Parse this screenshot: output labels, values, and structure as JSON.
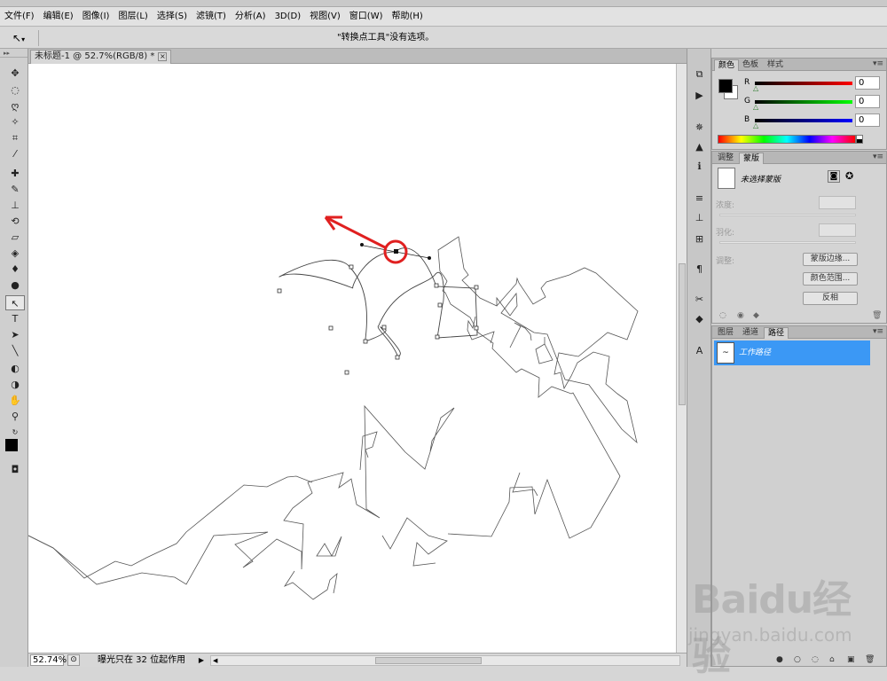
{
  "menu": [
    "文件(F)",
    "编辑(E)",
    "图像(I)",
    "图层(L)",
    "选择(S)",
    "滤镜(T)",
    "分析(A)",
    "3D(D)",
    "视图(V)",
    "窗口(W)",
    "帮助(H)"
  ],
  "options_bar": {
    "tool_icon": "convert-point-icon",
    "message": "\"转换点工具\"没有选项。"
  },
  "document": {
    "tab_title": "未标题-1 @ 52.7%(RGB/8) *",
    "close_glyph": "×"
  },
  "status": {
    "zoom": "52.74%",
    "text": "曝光只在 32 位起作用",
    "arrow": "▶",
    "left_arrow": "◀"
  },
  "color_panel": {
    "tabs": [
      "颜色",
      "色板",
      "样式"
    ],
    "active_tab": "颜色",
    "channels": [
      {
        "label": "R",
        "value": "0",
        "gradient": "red"
      },
      {
        "label": "G",
        "value": "0",
        "gradient": "green"
      },
      {
        "label": "B",
        "value": "0",
        "gradient": "blue"
      }
    ],
    "foreground": "#000000",
    "background": "#ffffff"
  },
  "masks_panel": {
    "tabs": [
      "调整",
      "蒙版"
    ],
    "active_tab": "蒙版",
    "no_mask": "未选择蒙版",
    "density_label": "浓度:",
    "feather_label": "羽化:",
    "refine_label": "调整:",
    "buttons": [
      "蒙版边缘...",
      "颜色范围...",
      "反相"
    ]
  },
  "paths_panel": {
    "tabs": [
      "图层",
      "通道",
      "路径"
    ],
    "active_tab": "路径",
    "items": [
      {
        "name": "工作路径",
        "selected": true
      }
    ],
    "bottom_icons": [
      "fill-path-icon",
      "stroke-path-icon",
      "load-selection-icon",
      "make-work-path-icon",
      "new-path-icon",
      "delete-path-icon"
    ]
  },
  "watermark": {
    "brand": "Baidu经验",
    "url": "jingyan.baidu.com"
  },
  "colors": {
    "annotation": "#e02020",
    "selection": "#3b98f5"
  }
}
